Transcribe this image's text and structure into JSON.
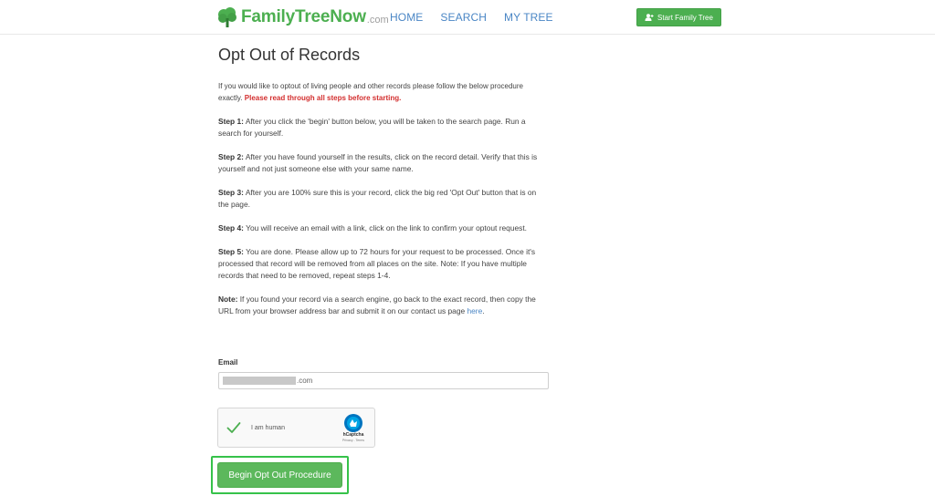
{
  "header": {
    "logo_text": "FamilyTreeNow",
    "logo_suffix": ".com",
    "nav": [
      {
        "label": "HOME"
      },
      {
        "label": "SEARCH"
      },
      {
        "label": "MY TREE"
      }
    ],
    "start_button": "Start Family Tree"
  },
  "main": {
    "title": "Opt Out of Records",
    "intro": "If you would like to optout of living people and other records please follow the below procedure exactly.",
    "intro_warning": "Please read through all steps before starting.",
    "steps": [
      {
        "label": "Step 1:",
        "text": "After you click the 'begin' button below, you will be taken to the search page. Run a search for yourself."
      },
      {
        "label": "Step 2:",
        "text": "After you have found yourself in the results, click on the record detail. Verify that this is yourself and not just someone else with your same name."
      },
      {
        "label": "Step 3:",
        "text": "After you are 100% sure this is your record, click the big red 'Opt Out' button that is on the page."
      },
      {
        "label": "Step 4:",
        "text": "You will receive an email with a link, click on the link to confirm your optout request."
      },
      {
        "label": "Step 5:",
        "text": "You are done. Please allow up to 72 hours for your request to be processed. Once it's processed that record will be removed from all places on the site. Note: If you have multiple records that need to be removed, repeat steps 1-4."
      }
    ],
    "note": {
      "label": "Note:",
      "text": "If you found your record via a search engine, go back to the exact record, then copy the URL from your browser address bar and submit it on our contact us page",
      "link": "here",
      "end": "."
    }
  },
  "form": {
    "email_label": "Email",
    "email_value_suffix": ".com",
    "captcha_label": "I am human",
    "captcha_brand": "hCaptcha",
    "captcha_terms": "Privacy - Terms",
    "submit_label": "Begin Opt Out Procedure"
  },
  "colors": {
    "brand_green": "#4caf50",
    "nav_blue": "#4a86c5",
    "warning_red": "#d32f2f",
    "highlight_green": "#36c24a"
  }
}
